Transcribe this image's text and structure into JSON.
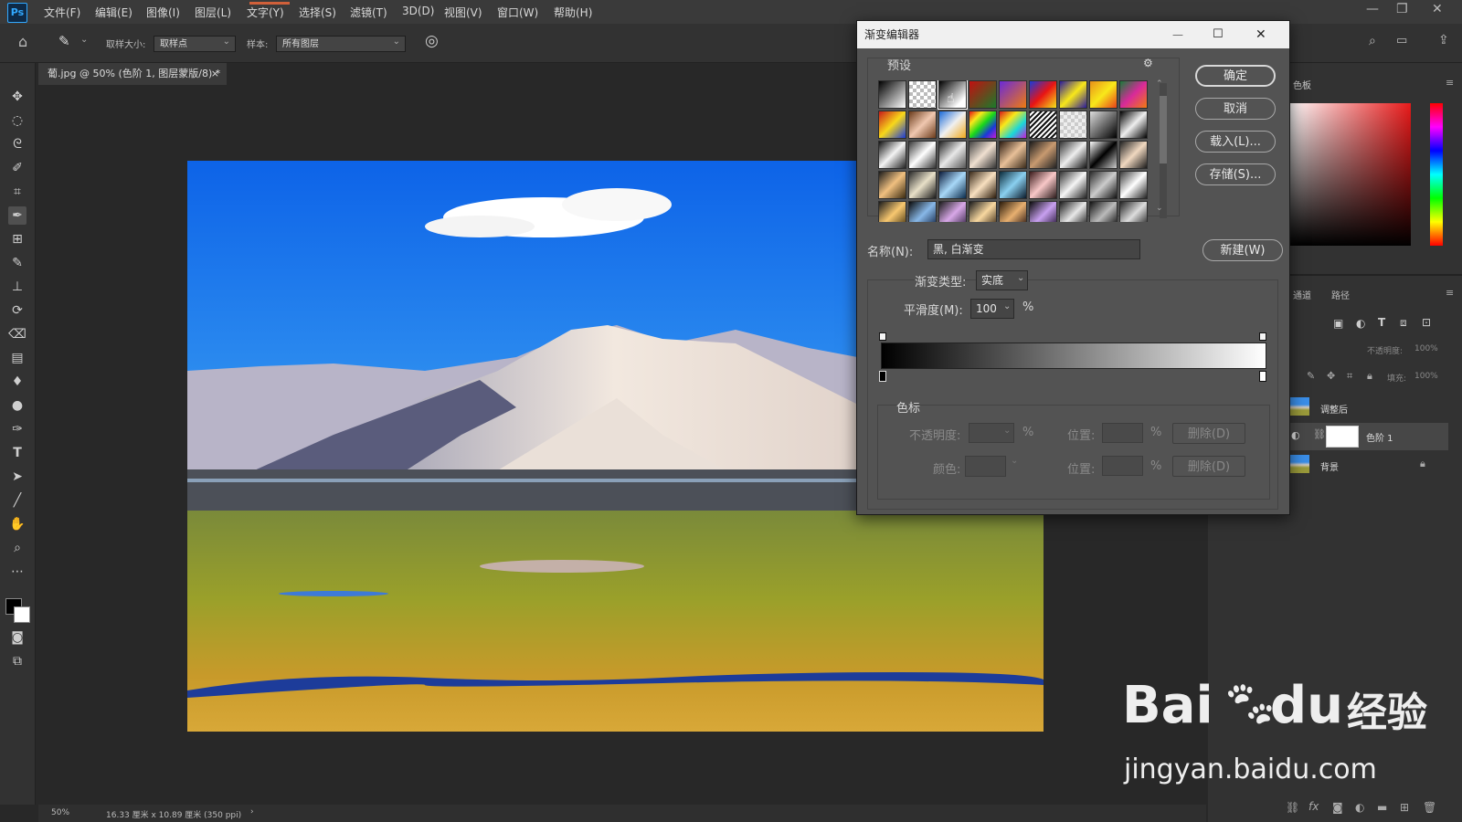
{
  "app": {
    "logo_text": "Ps",
    "menu": [
      "文件(F)",
      "编辑(E)",
      "图像(I)",
      "图层(L)",
      "文字(Y)",
      "选择(S)",
      "滤镜(T)",
      "3D(D)",
      "视图(V)",
      "窗口(W)",
      "帮助(H)"
    ]
  },
  "options_bar": {
    "sample_size_label": "取样大小:",
    "sample_size_value": "取样点",
    "sample_label": "样本:",
    "sample_value": "所有图层"
  },
  "document": {
    "tab_title": "葡.jpg @ 50% (色阶 1, 图层蒙版/8) *",
    "close": "×"
  },
  "statusbar": {
    "zoom": "50%",
    "doc_size": "16.33 厘米 x 10.89 厘米 (350 ppi)",
    "arrow": "›"
  },
  "right_panel": {
    "color_tab": "色板",
    "channels_tab": "通道",
    "paths_tab": "路径",
    "opacity_label": "不透明度:",
    "opacity_value": "100%",
    "fill_label": "填充:",
    "fill_value": "100%",
    "layers": [
      {
        "name": "调整后"
      },
      {
        "name": "色阶 1"
      },
      {
        "name": "背景"
      }
    ]
  },
  "gradient_editor": {
    "title": "渐变编辑器",
    "presets_label": "预设",
    "buttons": {
      "ok": "确定",
      "cancel": "取消",
      "load": "载入(L)...",
      "save": "存储(S)...",
      "new": "新建(W)",
      "delete1": "删除(D)",
      "delete2": "删除(D)"
    },
    "name_label": "名称(N):",
    "name_value": "黑, 白渐变",
    "type_label": "渐变类型:",
    "type_value": "实底",
    "smooth_label": "平滑度(M):",
    "smooth_value": "100",
    "percent": "%",
    "stops_label": "色标",
    "opacity_label": "不透明度:",
    "color_label": "颜色:",
    "location_label_1": "位置:",
    "location_label_2": "位置:",
    "presets": [
      "linear-gradient(135deg,#000,#fff)",
      "repeating-conic-gradient(#bbb 0 25%,#fff 0 50%) 0 0/8px 8px",
      "linear-gradient(135deg,#000,#fff 80%)",
      "linear-gradient(135deg,#c21010,#1b7a2a)",
      "linear-gradient(135deg,#6a2ad8,#f07a10)",
      "linear-gradient(135deg,#1b3ad8,#e81414,#f5e41a)",
      "linear-gradient(135deg,#2a1a9a,#f8e81a,#2a1a9a)",
      "linear-gradient(135deg,#e8901a,#f8e81a,#e8401a)",
      "linear-gradient(135deg,#1a7a3a,#d82a9a,#f07a10)",
      "linear-gradient(135deg,#c81a1a,#f8d81a,#1a3ad8)",
      "linear-gradient(135deg,#6a3a1a,#f0c8b0,#6a3a1a)",
      "linear-gradient(135deg,#1a6ad8,#f0f0f0,#f0a81a)",
      "linear-gradient(135deg,#e81414,#f8e81a,#1ad81a,#1a3ad8,#c81ad8)",
      "linear-gradient(135deg,#d81a1a,#f8e81a,#1ad8d8,#c81ad8)",
      "repeating-linear-gradient(135deg,#111 0 2px,#fff 2px 4px)",
      "repeating-conic-gradient(#ccc 0 25%,#eee 0 50%) 0 0/8px 8px",
      "linear-gradient(135deg,#ddd,#000)",
      "linear-gradient(135deg,#000,#eee,#000)",
      "linear-gradient(135deg,#111,#f4f4f4,#222)",
      "linear-gradient(135deg,#3a3a3a,#fff,#333)",
      "linear-gradient(135deg,#222,#e8e8e8,#555)",
      "linear-gradient(135deg,#444,#f0e0d0,#333)",
      "linear-gradient(135deg,#2a1a10,#e8c098,#3a2a1a)",
      "linear-gradient(135deg,#1a1a1a,#c89a70,#222)",
      "linear-gradient(135deg,#333,#eee,#111)",
      "linear-gradient(135deg,#fff,#000,#ccc)",
      "linear-gradient(135deg,#222,#f0d8c0,#1a1a1a)",
      "linear-gradient(135deg,#1a1a1a,#f0c080,#3a2a10)",
      "linear-gradient(135deg,#2a2a2a,#e8e0c8,#1a1a1a)",
      "linear-gradient(135deg,#0a1a3a,#a8d8f8,#0a2a4a)",
      "linear-gradient(135deg,#3a2a1a,#f8e0c0,#2a1a0a)",
      "linear-gradient(135deg,#0a2a3a,#8ad0f0,#0a1a2a)",
      "linear-gradient(135deg,#3a1a1a,#f8c8c8,#2a1a1a)",
      "linear-gradient(135deg,#333,#f5f5f5,#222)",
      "linear-gradient(135deg,#2a2a2a,#ccc,#111)",
      "linear-gradient(135deg,#3a3a3a,#fff,#222)",
      "linear-gradient(135deg,#1a1a1a,#f8c870,#3a2a0a)",
      "linear-gradient(135deg,#0a0a0a,#88b8e8,#0a1a3a)",
      "linear-gradient(135deg,#1a1a1a,#d8a8e8,#2a1a3a)",
      "linear-gradient(135deg,#1a1a1a,#f8d8a0,#2a1a0a)",
      "linear-gradient(135deg,#2a1a0a,#e8b070,#1a0a0a)",
      "linear-gradient(135deg,#0a0a0a,#c8a0f0,#1a0a2a)",
      "linear-gradient(135deg,#1a1a1a,#e8e8e8,#0a0a0a)",
      "linear-gradient(135deg,#111,#bbb,#000)",
      "linear-gradient(135deg,#222,#ddd,#111)"
    ]
  },
  "watermark": {
    "brand_left": "Bai",
    "brand_right": "经验",
    "url": "jingyan.baidu.com"
  },
  "colors": {
    "ui_dark": "#282828",
    "panel": "#323232",
    "dialog": "#535353",
    "accent": "#31a8ff"
  }
}
